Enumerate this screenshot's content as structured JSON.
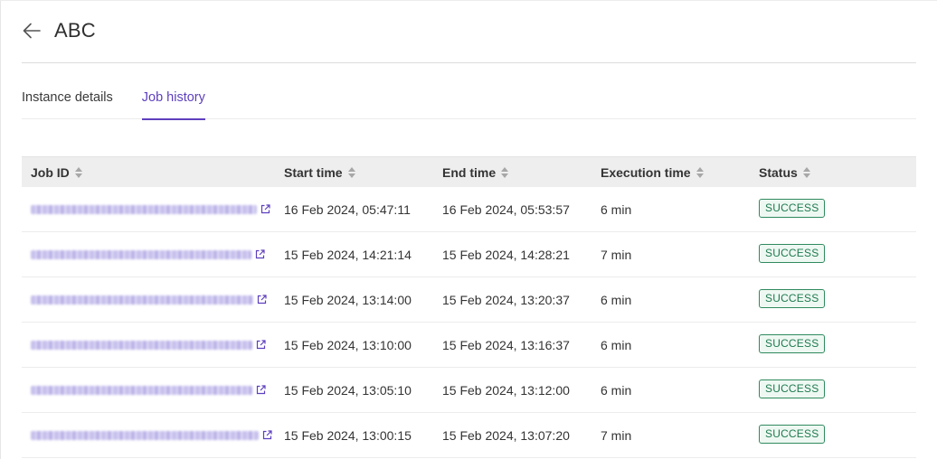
{
  "header": {
    "title": "ABC",
    "back_icon": "arrow-left-icon"
  },
  "tabs": [
    {
      "label": "Instance details",
      "active": false
    },
    {
      "label": "Job history",
      "active": true
    }
  ],
  "table": {
    "columns": [
      "Job ID",
      "Start time",
      "End time",
      "Execution time",
      "Status"
    ],
    "rows": [
      {
        "start": "16 Feb 2024, 05:47:11",
        "end": "16 Feb 2024, 05:53:57",
        "exec": "6 min",
        "status": "SUCCESS"
      },
      {
        "start": "15 Feb 2024, 14:21:14",
        "end": "15 Feb 2024, 14:28:21",
        "exec": "7 min",
        "status": "SUCCESS"
      },
      {
        "start": "15 Feb 2024, 13:14:00",
        "end": "15 Feb 2024, 13:20:37",
        "exec": "6 min",
        "status": "SUCCESS"
      },
      {
        "start": "15 Feb 2024, 13:10:00",
        "end": "15 Feb 2024, 13:16:37",
        "exec": "6 min",
        "status": "SUCCESS"
      },
      {
        "start": "15 Feb 2024, 13:05:10",
        "end": "15 Feb 2024, 13:12:00",
        "exec": "6 min",
        "status": "SUCCESS"
      },
      {
        "start": "15 Feb 2024, 13:00:15",
        "end": "15 Feb 2024, 13:07:20",
        "exec": "7 min",
        "status": "SUCCESS"
      }
    ]
  },
  "colors": {
    "accent": "#5e3fbe",
    "success_text": "#1d7a4e",
    "success_border": "#2f8a5e",
    "header_bg": "#eeeeee"
  }
}
